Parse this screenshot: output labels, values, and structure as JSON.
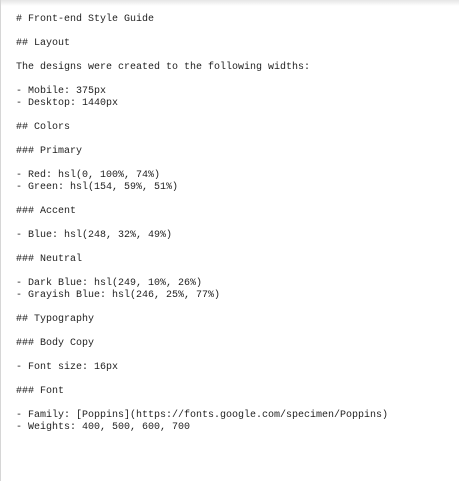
{
  "document": {
    "blocks": [
      {
        "lines": [
          "# Front-end Style Guide"
        ]
      },
      {
        "lines": [
          "## Layout"
        ]
      },
      {
        "lines": [
          "The designs were created to the following widths:"
        ]
      },
      {
        "lines": [
          "- Mobile: 375px",
          "- Desktop: 1440px"
        ]
      },
      {
        "lines": [
          "## Colors"
        ]
      },
      {
        "lines": [
          "### Primary"
        ]
      },
      {
        "lines": [
          "- Red: hsl(0, 100%, 74%)",
          "- Green: hsl(154, 59%, 51%)"
        ]
      },
      {
        "lines": [
          "### Accent"
        ]
      },
      {
        "lines": [
          "- Blue: hsl(248, 32%, 49%)"
        ]
      },
      {
        "lines": [
          "### Neutral"
        ]
      },
      {
        "lines": [
          "- Dark Blue: hsl(249, 10%, 26%)",
          "- Grayish Blue: hsl(246, 25%, 77%)"
        ]
      },
      {
        "lines": [
          "## Typography"
        ]
      },
      {
        "lines": [
          "### Body Copy"
        ]
      },
      {
        "lines": [
          "- Font size: 16px"
        ]
      },
      {
        "lines": [
          "### Font"
        ]
      },
      {
        "lines": [
          "- Family: [Poppins](https://fonts.google.com/specimen/Poppins)",
          "- Weights: 400, 500, 600, 700"
        ]
      }
    ]
  }
}
